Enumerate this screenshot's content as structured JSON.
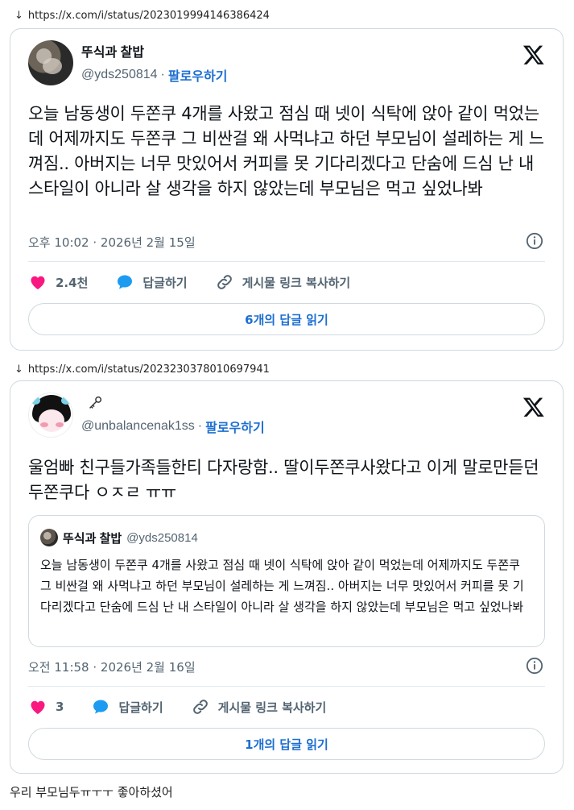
{
  "tweets": [
    {
      "url": "https://x.com/i/status/2023019994146386424",
      "author_name": "뚜식과 찰밥",
      "handle": "@yds250814",
      "follow_label": "팔로우하기",
      "text": "오늘 남동생이 두쫀쿠 4개를 사왔고 점심 때 넷이 식탁에 앉아 같이 먹었는데 어제까지도 두쫀쿠 그 비싼걸 왜 사먹냐고 하던 부모님이 설레하는 게 느껴짐.. 아버지는 너무 맛있어서 커피를 못 기다리겠다고 단숨에 드심 난 내 스타일이 아니라 살 생각을 하지 않았는데 부모님은 먹고 싶었나봐",
      "timestamp": "오후 10:02 · 2026년 2월 15일",
      "likes": "2.4천",
      "reply_label": "답글하기",
      "copy_link_label": "게시물 링크 복사하기",
      "read_replies_label": "6개의 답글 읽기"
    },
    {
      "url": "https://x.com/i/status/2023230378010697941",
      "author_name": "",
      "handle": "@unbalancenak1ss",
      "follow_label": "팔로우하기",
      "text": "울엄빠 친구들가족들한티 다자랑함.. 딸이두쫀쿠사왔다고 이게 말로만듣던두쫀쿠다 ㅇㅈㄹ ㅠㅠ",
      "quote": {
        "author_name": "뚜식과 찰밥",
        "handle": "@yds250814",
        "text": "오늘 남동생이 두쫀쿠 4개를 사왔고 점심 때 넷이 식탁에 앉아 같이 먹었는데 어제까지도 두쫀쿠 그 비싼걸 왜 사먹냐고 하던 부모님이 설레하는 게 느껴짐.. 아버지는 너무 맛있어서 커피를 못 기다리겠다고 단숨에 드심 난 내 스타일이 아니라 살 생각을 하지 않았는데 부모님은 먹고 싶었나봐"
      },
      "timestamp": "오전 11:58 · 2026년 2월 16일",
      "likes": "3",
      "reply_label": "답글하기",
      "copy_link_label": "게시물 링크 복사하기",
      "read_replies_label": "1개의 답글 읽기"
    }
  ],
  "caption": "우리 부모님두ㅠㅜㅜ 좋아하셨어",
  "colors": {
    "like": "#f91880",
    "reply": "#1d9bf0",
    "link": "#1d6fd1"
  },
  "icons": [
    "down-arrow-icon",
    "x-logo-icon",
    "heart-icon",
    "reply-bubble-icon",
    "link-icon",
    "info-icon",
    "key-icon"
  ]
}
